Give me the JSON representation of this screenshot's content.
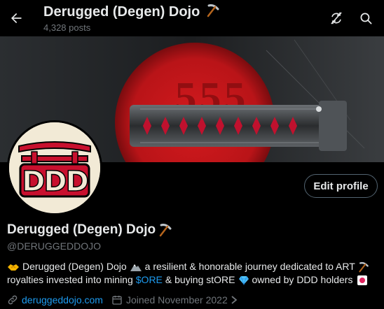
{
  "header": {
    "title": "Derugged (Degen) Dojo",
    "posts_count": "4,328 posts"
  },
  "banner": {
    "sun_number": "555"
  },
  "avatar": {
    "logo_text": "DDD"
  },
  "actions": {
    "edit_profile_label": "Edit profile"
  },
  "profile": {
    "display_name": "Derugged (Degen) Dojo",
    "handle": "@DERUGGEDDOJO",
    "bio": {
      "line1_part1": "Derugged (Degen) Dojo",
      "line1_part2": "a resilient & honorable journey dedicated to ART",
      "line2_part1": "royalties invested into mining",
      "cashtag": "$ORE",
      "line2_part2": "& buying stORE",
      "line2_part3": "owned by DDD holders"
    },
    "website": "deruggeddojo.com",
    "joined": "Joined November 2022"
  },
  "colors": {
    "background": "#000000",
    "text": "#e7e9ea",
    "muted": "#71767b",
    "accent": "#1d9bf0",
    "banner_red": "#c4151b"
  },
  "icons": [
    "back-arrow-icon",
    "pickaxe-icon",
    "sync-off-icon",
    "search-icon",
    "handshake-icon",
    "mountain-icon",
    "gem-icon",
    "sticker-icon",
    "link-icon",
    "calendar-icon",
    "chevron-right-icon"
  ]
}
